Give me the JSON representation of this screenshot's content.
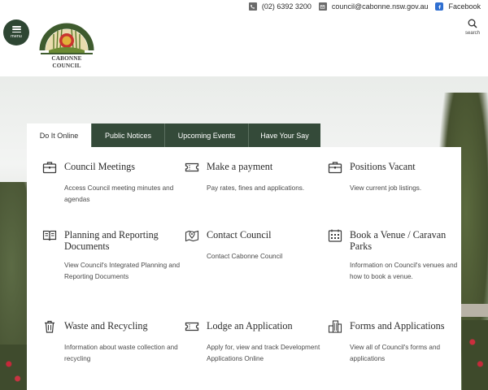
{
  "topbar": {
    "phone": "(02) 6392 3200",
    "email": "council@cabonne.nsw.gov.au",
    "facebook": "Facebook"
  },
  "header": {
    "menu_label": "menu",
    "logo_text": "CABONNE COUNCIL",
    "search_label": "search"
  },
  "tabs": [
    {
      "label": "Do It Online",
      "active": true
    },
    {
      "label": "Public Notices",
      "active": false
    },
    {
      "label": "Upcoming Events",
      "active": false
    },
    {
      "label": "Have Your Say",
      "active": false
    }
  ],
  "cards": [
    {
      "icon": "briefcase-icon",
      "title": "Council Meetings",
      "desc": "Access Council meeting minutes and agendas"
    },
    {
      "icon": "ticket-icon",
      "title": "Make a payment",
      "desc": "Pay rates, fines and applications."
    },
    {
      "icon": "briefcase-icon",
      "title": "Positions Vacant",
      "desc": "View current job listings."
    },
    {
      "icon": "book-icon",
      "title": "Planning and Reporting Documents",
      "desc": "View Council's Integrated Planning and Reporting Documents"
    },
    {
      "icon": "map-pin-icon",
      "title": "Contact Council",
      "desc": "Contact Cabonne Council"
    },
    {
      "icon": "calendar-icon",
      "title": "Book a Venue / Caravan Parks",
      "desc": "Information on Council's venues and how to book a venue."
    },
    {
      "icon": "trash-icon",
      "title": "Waste and Recycling",
      "desc": "Information about waste collection and recycling"
    },
    {
      "icon": "ticket-icon",
      "title": "Lodge an Application",
      "desc": "Apply for, view and track Development Applications Online"
    },
    {
      "icon": "buildings-icon",
      "title": "Forms and Applications",
      "desc": "View all of Council's forms and applications"
    }
  ]
}
